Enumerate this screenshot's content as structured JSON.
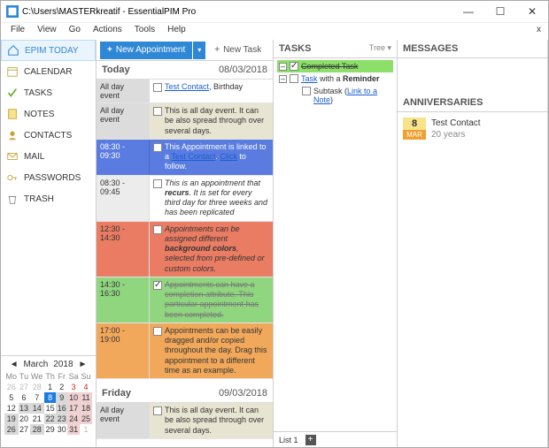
{
  "window": {
    "path": "C:\\Users\\MASTERkreatif - EssentialPIM Pro"
  },
  "menu": [
    "File",
    "View",
    "Go",
    "Actions",
    "Tools",
    "Help"
  ],
  "sidebar": {
    "items": [
      {
        "label": "EPIM TODAY"
      },
      {
        "label": "CALENDAR"
      },
      {
        "label": "TASKS"
      },
      {
        "label": "NOTES"
      },
      {
        "label": "CONTACTS"
      },
      {
        "label": "MAIL"
      },
      {
        "label": "PASSWORDS"
      },
      {
        "label": "TRASH"
      }
    ]
  },
  "minical": {
    "month": "March",
    "year": "2018",
    "dow": [
      "Mo",
      "Tu",
      "We",
      "Th",
      "Fr",
      "Sa",
      "Su"
    ],
    "rows": [
      [
        "26",
        "27",
        "28",
        "1",
        "2",
        "3",
        "4"
      ],
      [
        "5",
        "6",
        "7",
        "8",
        "9",
        "10",
        "11"
      ],
      [
        "12",
        "13",
        "14",
        "15",
        "16",
        "17",
        "18"
      ],
      [
        "19",
        "20",
        "21",
        "22",
        "23",
        "24",
        "25"
      ],
      [
        "26",
        "27",
        "28",
        "29",
        "30",
        "31",
        "1"
      ]
    ]
  },
  "toolbar": {
    "newAppt": "New Appointment",
    "newTask": "New Task"
  },
  "today": {
    "title": "Today",
    "date": "08/03/2018",
    "events": [
      {
        "time": "All day event",
        "checked": false,
        "html": "<span class='link'>Test Contact</span>, Birthday"
      },
      {
        "time": "All day event",
        "checked": false,
        "html": "This is all day event. It can be also spread through over several days."
      },
      {
        "time": "08:30 - 09:30",
        "checked": false,
        "html": "This Appointment is linked to a <span class='link'>Test Contact</span>. <span class='link'>Click</span> to follow."
      },
      {
        "time": "08:30 - 09:45",
        "checked": false,
        "html": "<i>This is an appointment that <b>recurs</b>. It is set for every third day for three weeks and has been replicated</i>"
      },
      {
        "time": "12:30 - 14:30",
        "checked": false,
        "html": "<i>Appointments can be assigned different <b>background colors</b>, selected from pre-defined or custom colors.</i>"
      },
      {
        "time": "14:30 - 16:30",
        "checked": true,
        "html": "<span class='strike'>Appointments can have a completion attribute. This particular appointment has been completed.</span>"
      },
      {
        "time": "17:00 - 19:00",
        "checked": false,
        "html": "Appointments can be easily dragged and/or copied throughout the day. Drag this appointment to a different time as an example."
      }
    ]
  },
  "friday": {
    "title": "Friday",
    "date": "09/03/2018",
    "events": [
      {
        "time": "All day event",
        "checked": false,
        "html": "This is all day event. It can be also spread through over several days."
      }
    ]
  },
  "tasks": {
    "title": "TASKS",
    "mode": "Tree",
    "items": [
      {
        "done": true,
        "html": "Completed Task"
      },
      {
        "done": false,
        "html": "<span class='link'>Task</span> with a <b>Reminder</b>"
      },
      {
        "done": false,
        "sub": true,
        "html": "Subtask (<span class='link'>Link to a Note</span>)"
      }
    ],
    "listTab": "List 1"
  },
  "messages": {
    "title": "MESSAGES"
  },
  "anniv": {
    "title": "ANNIVERSARIES",
    "day": "8",
    "mon": "MAR",
    "name": "Test Contact",
    "years": "20 years"
  }
}
